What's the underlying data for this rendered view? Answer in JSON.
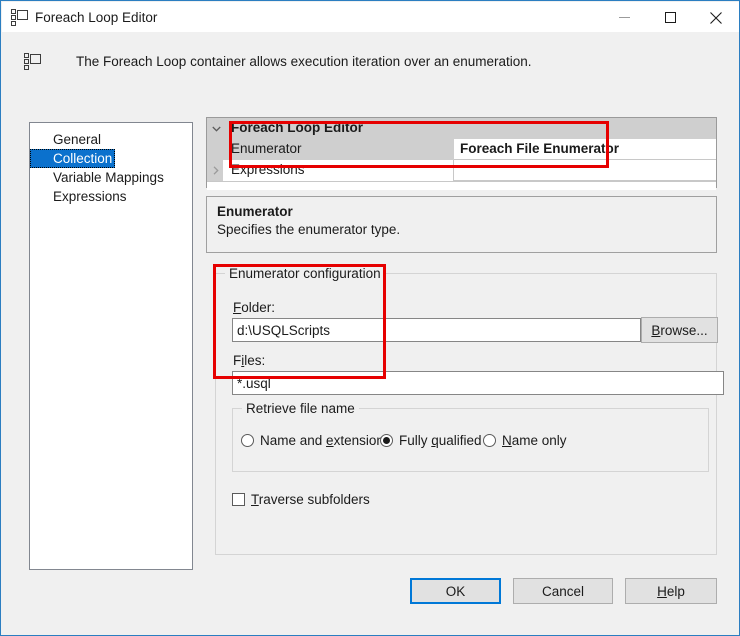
{
  "window": {
    "title": "Foreach Loop Editor",
    "icon": "foreach-loop-icon",
    "controls": {
      "minimize": "minimize-icon",
      "maximize": "maximize-icon",
      "close": "close-icon"
    }
  },
  "header": {
    "icon": "foreach-loop-icon",
    "description": "The Foreach Loop container allows execution iteration over an enumeration."
  },
  "sidebar": {
    "items": [
      {
        "label": "General",
        "selected": false
      },
      {
        "label": "Collection",
        "selected": true
      },
      {
        "label": "Variable Mappings",
        "selected": false
      },
      {
        "label": "Expressions",
        "selected": false
      }
    ]
  },
  "property_grid": {
    "category": {
      "label": "Foreach Loop Editor",
      "expander": "chevron-down-icon",
      "expanded": true
    },
    "rows": [
      {
        "name": "Enumerator",
        "value": "Foreach File Enumerator",
        "expander": ""
      },
      {
        "name": "Expressions",
        "value": "",
        "expander": "chevron-right-icon"
      }
    ]
  },
  "description_panel": {
    "title": "Enumerator",
    "text": "Specifies the enumerator type."
  },
  "enumerator_configuration": {
    "legend": "Enumerator configuration",
    "folder": {
      "label_pre": "F",
      "label_mnemonic": "",
      "label": "Folder:",
      "value": "d:\\USQLScripts",
      "placeholder": ""
    },
    "browse_button": {
      "label_before": "",
      "mnemonic": "B",
      "label_after": "rowse..."
    },
    "files": {
      "label_before": "F",
      "mnemonic": "i",
      "label_after": "les:",
      "value": "*.usql",
      "placeholder": ""
    },
    "retrieve_file_name": {
      "legend": "Retrieve file name",
      "options": [
        {
          "before": "Name and ",
          "mnemonic": "e",
          "after": "xtension",
          "checked": false
        },
        {
          "before": "Fully ",
          "mnemonic": "q",
          "after": "ualified",
          "checked": true
        },
        {
          "before": "",
          "mnemonic": "N",
          "after": "ame only",
          "checked": false
        }
      ]
    },
    "traverse_subfolders": {
      "before": "",
      "mnemonic": "T",
      "after": "raverse subfolders",
      "checked": false
    }
  },
  "footer": {
    "ok": {
      "label": "OK"
    },
    "cancel": {
      "label": "Cancel"
    },
    "help": {
      "before": "",
      "mnemonic": "H",
      "after": "elp"
    }
  },
  "annotations": {
    "accent_color": "#e60000",
    "boxes": [
      {
        "name": "enumerator-row-highlight"
      },
      {
        "name": "folder-files-highlight"
      }
    ]
  }
}
